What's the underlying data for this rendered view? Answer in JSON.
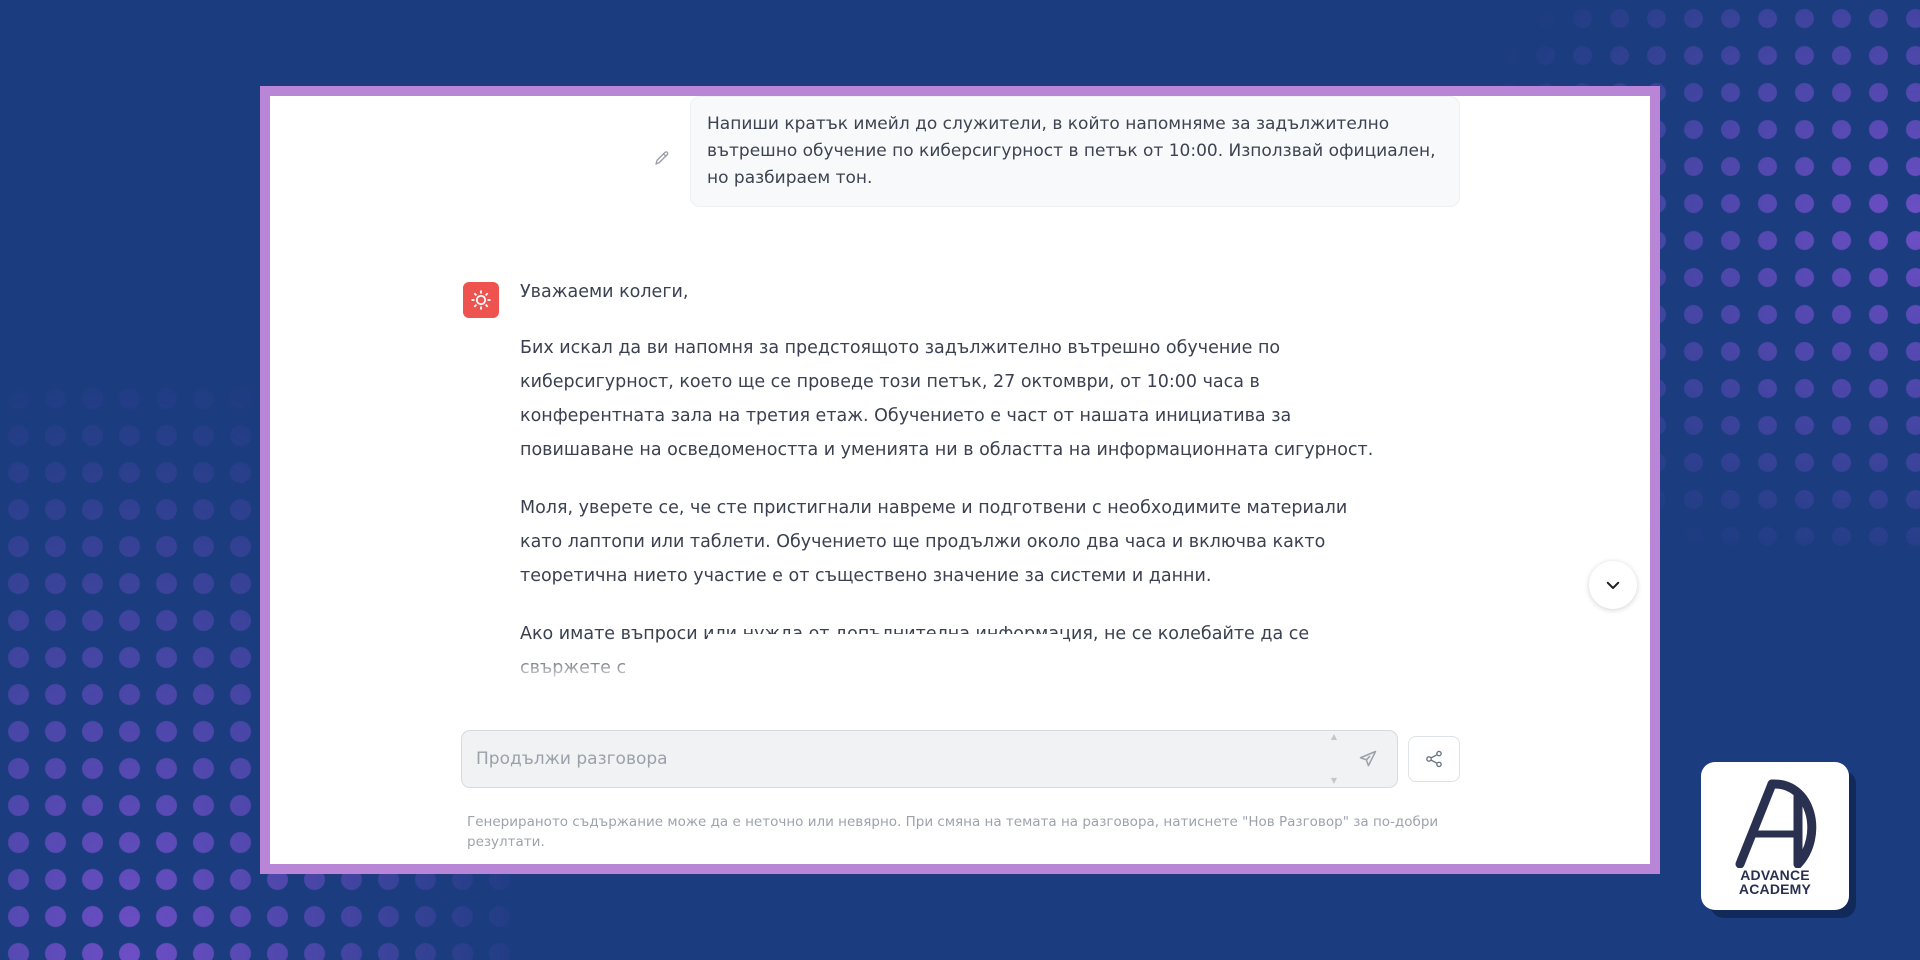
{
  "colors": {
    "background": "#1b3c7f",
    "frame": "#b985d6",
    "accent_dots": "#6e4fc6",
    "assistant_avatar": "#ef5350"
  },
  "user_message": {
    "text": "Напиши кратък имейл до служители, в който напомняме за задължително вътрешно обучение по киберсигурност в петък от 10:00. Използвай официален, но разбираем тон.",
    "edit_icon": "pencil-icon"
  },
  "assistant_message": {
    "avatar_icon": "gear-icon",
    "paragraphs": [
      "Уважаеми колеги,",
      "Бих искал да ви напомня за предстоящото задължително вътрешно обучение по киберсигурност, което ще се проведе този петък, 27 октомври, от 10:00 часа в конферентната зала на третия етаж. Обучението е част от нашата инициатива за повишаване на осведомеността и уменията ни в областта на информационната сигурност.",
      "Моля, уверете се, че сте пристигнали навреме и подготвени с необходимите материали като лаптопи или таблети. Обучението ще продължи около два часа и включва както теоретична                                        нието участие е от съществено значение за                                        системи и данни.",
      "Ако имате въпроси или нужда от допълнителна информация, не се колебайте да се свържете с"
    ]
  },
  "scroll_down_icon": "chevron-down-icon",
  "composer": {
    "placeholder": "Продължи разговора",
    "value": "",
    "send_icon": "send-icon",
    "share_icon": "share-icon"
  },
  "disclaimer": "Генерираното съдържание може да е неточно или невярно. При смяна на темата на разговора, натиснете \"Нов Разговор\" за по-добри резултати.",
  "brand": {
    "line1": "ADVANCE",
    "line2": "ACADEMY"
  }
}
